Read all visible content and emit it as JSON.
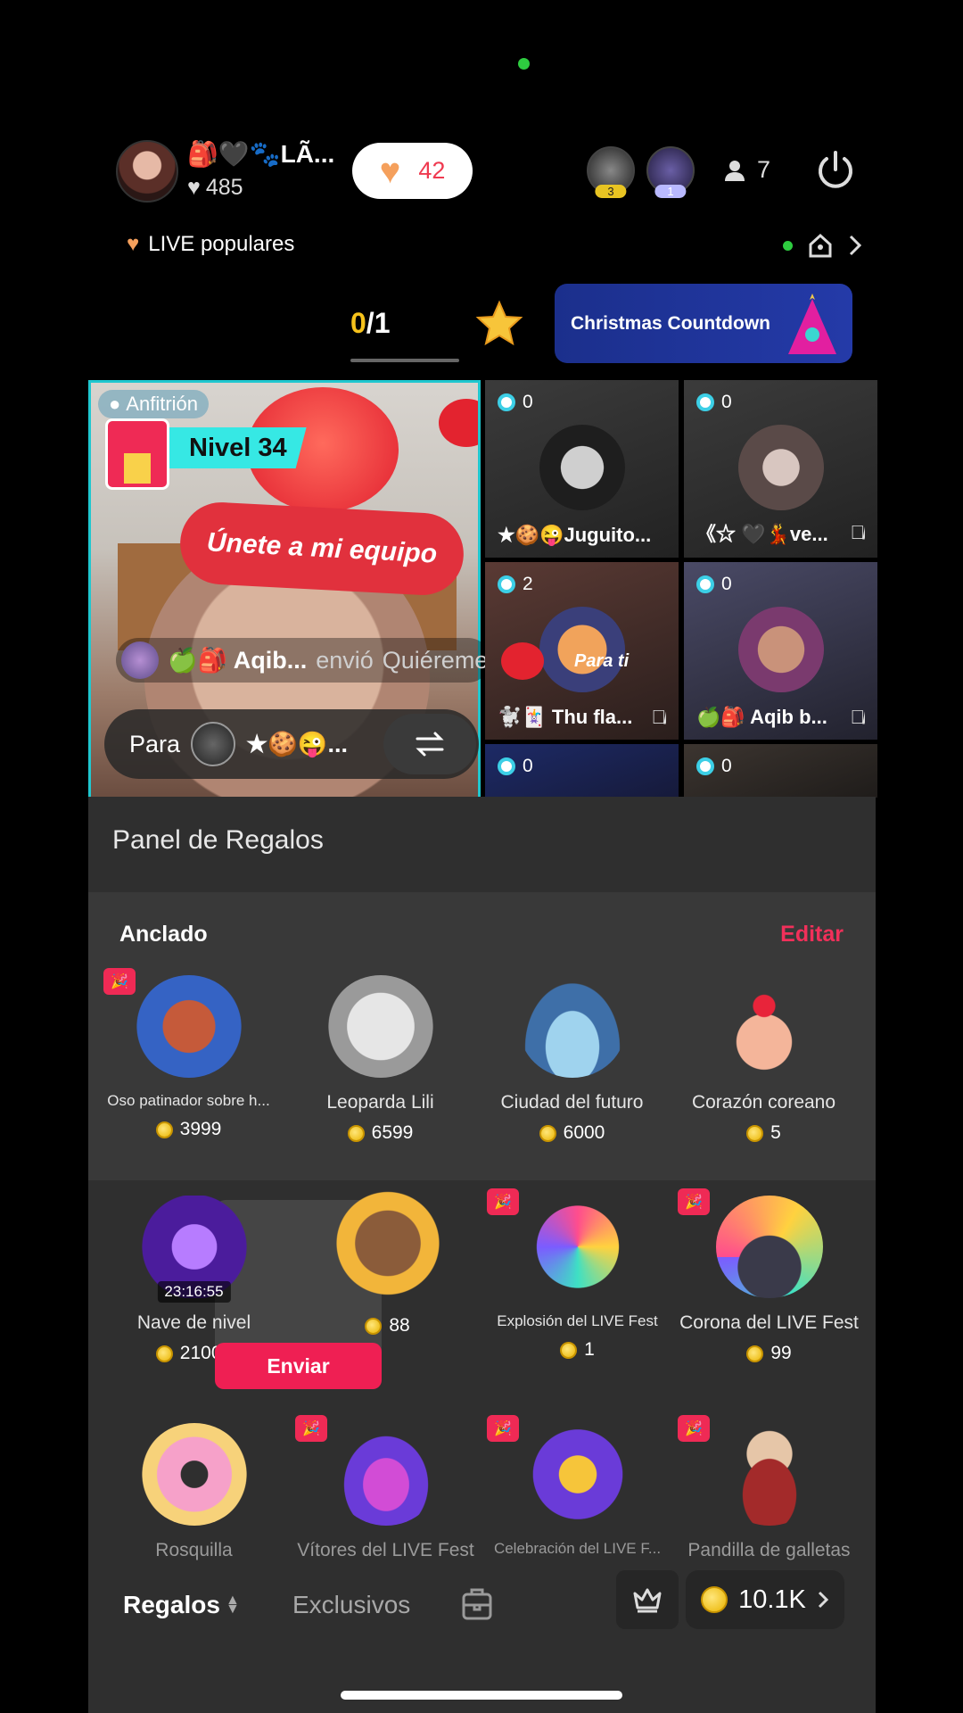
{
  "header": {
    "host_name": "🎒🖤🐾LÃ...",
    "host_likes": "485",
    "like_count": "42",
    "viewers": [
      {
        "rank": "3"
      },
      {
        "rank": "1"
      }
    ],
    "viewer_count": "7"
  },
  "live_bar": {
    "label": "LIVE populares"
  },
  "battle": {
    "score_current": "0",
    "score_total": "/1",
    "banner": "Christmas Countdown"
  },
  "host_tile": {
    "role": "Anfitrión",
    "level": "Nivel 34",
    "join_label": "Únete a mi equipo",
    "sent": {
      "user": "🍏🎒 Aqib...",
      "verb": "envió",
      "gift": "Quiéreme"
    },
    "para": {
      "label": "Para",
      "target": "★🍪😜..."
    }
  },
  "guests": [
    {
      "score": "0",
      "name": "★🍪😜Juguito...",
      "muted": false
    },
    {
      "score": "0",
      "name": "《☆ 🖤💃ve...",
      "muted": true
    },
    {
      "score": "2",
      "name": "🐩🃏 Thu fla...",
      "muted": true,
      "overlay": "Para ti"
    },
    {
      "score": "0",
      "name": "🍏🎒 Aqib b...",
      "muted": true
    },
    {
      "score": "0"
    },
    {
      "score": "0"
    }
  ],
  "panel": {
    "title": "Panel de Regalos",
    "pinned_label": "Anclado",
    "edit_label": "Editar",
    "pinned": [
      {
        "name": "Oso patinador sobre h...",
        "price": "3999"
      },
      {
        "name": "Leoparda Lili",
        "price": "6599"
      },
      {
        "name": "Ciudad del futuro",
        "price": "6000"
      },
      {
        "name": "Corazón coreano",
        "price": "5"
      }
    ],
    "row2": [
      {
        "name": "Nave de nivel",
        "price": "21000",
        "timer": "23:16:55"
      },
      {
        "name": "",
        "price": "88",
        "send": "Enviar"
      },
      {
        "name": "Explosión del LIVE Fest",
        "price": "1"
      },
      {
        "name": "Corona del LIVE Fest",
        "price": "99"
      }
    ],
    "row3": [
      {
        "name": "Rosquilla"
      },
      {
        "name": "Vítores del LIVE Fest"
      },
      {
        "name": "Celebración del LIVE F..."
      },
      {
        "name": "Pandilla de galletas"
      }
    ]
  },
  "bottom": {
    "tab_gifts": "Regalos",
    "tab_exclusive": "Exclusivos",
    "balance": "10.1K"
  },
  "colors": {
    "accent": "#ef1f53",
    "cyan": "#36e8e4",
    "coin": "#f3c419"
  }
}
